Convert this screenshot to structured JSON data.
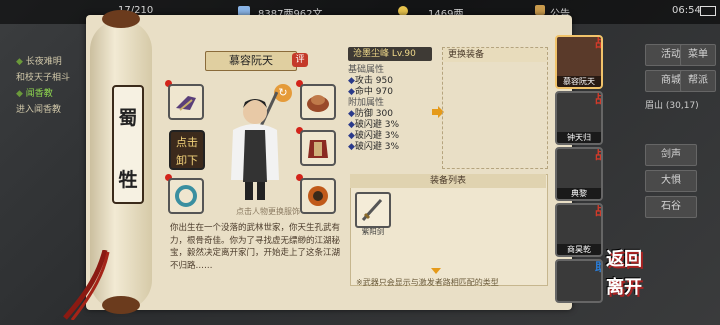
{
  "topbar": {
    "stamina": "17/210",
    "silver": "8387两962文",
    "gold": "1469两",
    "announce": "公告",
    "time": "06:54"
  },
  "quest": {
    "items": [
      "长夜难明",
      "和枝天子相斗",
      "闻香教",
      "进入闻香教"
    ]
  },
  "right_menu": [
    "活动",
    "菜单",
    "商城",
    "帮派",
    "眉山",
    "剑声",
    "大惧",
    "石谷"
  ],
  "right_menu_extra": "(30,17)",
  "sect": {
    "char1": "蜀",
    "char2": "牲"
  },
  "character": {
    "name": "慕容阮天",
    "badge": "评",
    "hint": "点击人物更换服饰",
    "description": "你出生在一个没落的武林世家，你天生孔武有力，根骨奇佳。你为了寻找虚无缥缈的江湖秘宝，毅然决定离开家门，开始走上了这条江湖不归路……"
  },
  "unequip_button": {
    "line1": "点击",
    "line2": "卸下"
  },
  "stats": {
    "level_title": "沧墨尘峰 Lv.90",
    "base_header": "基础属性",
    "attack": "攻击 950",
    "hit": "命中 970",
    "bonus_header": "附加属性",
    "defense": "防御 300",
    "dodge1": "破闪避 3%",
    "dodge2": "破闪避 3%",
    "dodge3": "破闪避 3%"
  },
  "change_equip": {
    "title": "更换装备"
  },
  "equip_list": {
    "title": "装备列表",
    "item_name": "紫阳剑",
    "note": "※武器只会显示与激发者路相匹配的类型"
  },
  "roster": [
    {
      "name": "慕容阮天",
      "tag": "战"
    },
    {
      "name": "钟天归",
      "tag": "战"
    },
    {
      "name": "典黎",
      "tag": "战"
    },
    {
      "name": "商昊乾",
      "tag": "战"
    },
    {
      "name": "",
      "tag": "助"
    }
  ],
  "back_button": {
    "line1": "返回",
    "line2": "离开"
  },
  "colors": {
    "accent_red": "#d23a2a",
    "gold_text": "#f0d98a",
    "scroll_bg": "#e9dfc6"
  }
}
